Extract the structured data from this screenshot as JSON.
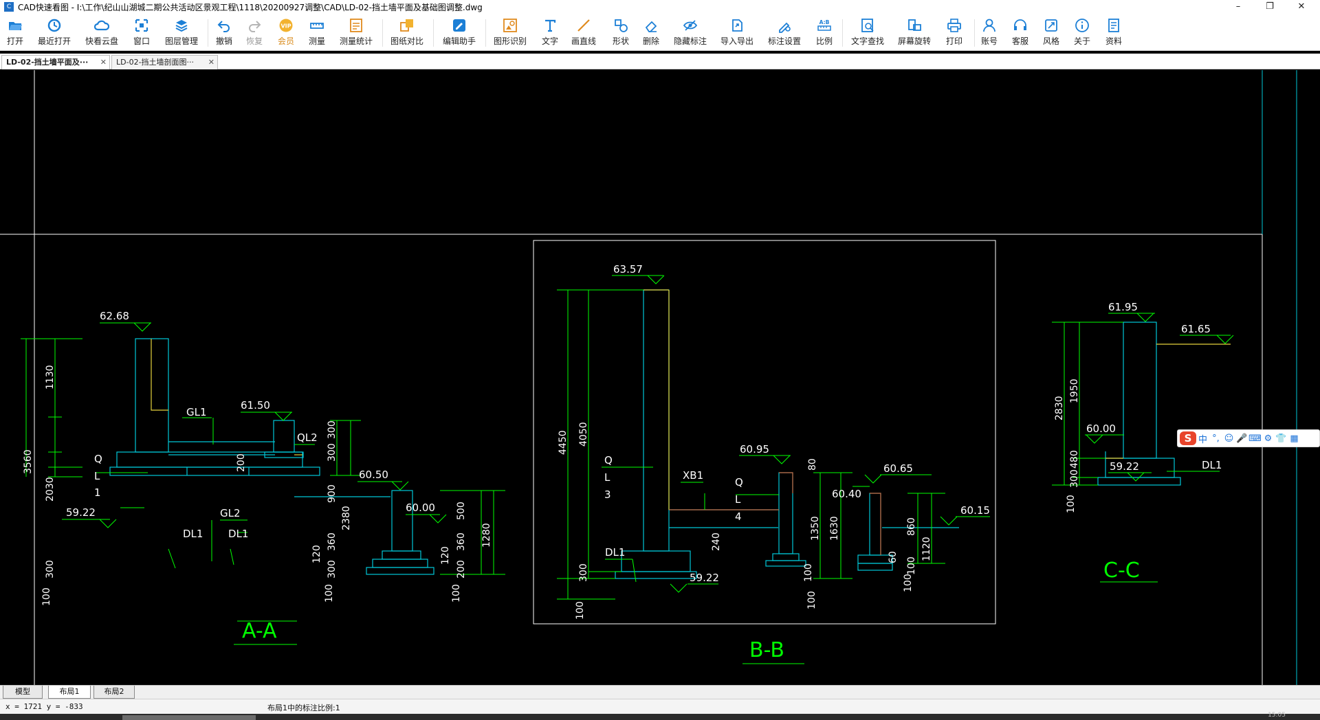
{
  "window": {
    "app_icon_text": "C",
    "title": "CAD快速看图 - I:\\工作\\纪山山湖城二期公共活动区景观工程\\1118\\20200927调整\\CAD\\LD-02-挡土墙平面及基础图调整.dwg",
    "minimize": "–",
    "maximize": "❐",
    "close": "✕"
  },
  "toolbar": {
    "items": [
      {
        "label": "打开",
        "icon": "folder-open-icon"
      },
      {
        "label": "最近打开",
        "icon": "recent-clock-icon"
      },
      {
        "label": "快看云盘",
        "icon": "cloud-icon"
      },
      {
        "label": "窗口",
        "icon": "window-icon"
      },
      {
        "label": "图层管理",
        "icon": "layers-icon"
      },
      {
        "label": "撤销",
        "icon": "undo-icon"
      },
      {
        "label": "恢复",
        "icon": "redo-icon"
      },
      {
        "label": "会员",
        "icon": "vip-icon"
      },
      {
        "label": "测量",
        "icon": "ruler-icon"
      },
      {
        "label": "测量统计",
        "icon": "measure-stats-icon"
      },
      {
        "label": "图纸对比",
        "icon": "compare-icon"
      },
      {
        "label": "编辑助手",
        "icon": "edit-assistant-icon"
      },
      {
        "label": "图形识别",
        "icon": "shape-recognize-icon"
      },
      {
        "label": "文字",
        "icon": "text-icon"
      },
      {
        "label": "画直线",
        "icon": "line-icon"
      },
      {
        "label": "形状",
        "icon": "shapes-icon"
      },
      {
        "label": "删除",
        "icon": "eraser-icon"
      },
      {
        "label": "隐藏标注",
        "icon": "hide-annotation-icon"
      },
      {
        "label": "导入导出",
        "icon": "import-export-icon"
      },
      {
        "label": "标注设置",
        "icon": "annotation-settings-icon"
      },
      {
        "label": "比例",
        "icon": "scale-icon"
      },
      {
        "label": "文字查找",
        "icon": "text-search-icon"
      },
      {
        "label": "屏幕旋转",
        "icon": "rotate-screen-icon"
      },
      {
        "label": "打印",
        "icon": "printer-icon"
      },
      {
        "label": "账号",
        "icon": "account-icon"
      },
      {
        "label": "客服",
        "icon": "headset-icon"
      },
      {
        "label": "风格",
        "icon": "style-icon"
      },
      {
        "label": "关于",
        "icon": "info-icon"
      },
      {
        "label": "资料",
        "icon": "documents-icon"
      }
    ]
  },
  "tabs": [
    {
      "label": "LD-02-挡土墙平面及···",
      "active": true,
      "close": "✕"
    },
    {
      "label": "LD-02-挡土墙剖面图···",
      "active": false,
      "close": "✕"
    }
  ],
  "drawing": {
    "sections": {
      "aa": {
        "title": "A-A"
      },
      "bb": {
        "title": "B-B"
      },
      "cc": {
        "title": "C-C"
      }
    },
    "elevations": [
      "62.68",
      "61.50",
      "60.50",
      "60.00",
      "59.22",
      "63.57",
      "60.95",
      "60.40",
      "60.65",
      "60.15",
      "59.22",
      "61.95",
      "61.65",
      "60.00",
      "59.22"
    ],
    "member_labels": [
      "GL1",
      "QL2",
      "Q",
      "L",
      "1",
      "GL2",
      "DL1",
      "DL1",
      "Q",
      "L",
      "3",
      "XB1",
      "Q",
      "L",
      "4",
      "DL1",
      "DL1"
    ],
    "dimensions_aa": [
      "1130",
      "3560",
      "2030",
      "300",
      "100",
      "200",
      "300",
      "300",
      "900",
      "2380",
      "360",
      "300",
      "120",
      "100",
      "500",
      "360",
      "1280",
      "120",
      "200",
      "100"
    ],
    "dimensions_bb": [
      "4450",
      "4050",
      "300",
      "100",
      "240",
      "80",
      "1350",
      "1630",
      "100",
      "100",
      "860",
      "1120",
      "100",
      "60",
      "100"
    ],
    "dimensions_cc": [
      "2830",
      "1950",
      "480",
      "300",
      "100"
    ]
  },
  "ime": {
    "logo": "S",
    "glyphs": [
      "中",
      "°,",
      "☺",
      "🎤",
      "⌨",
      "⚙",
      "👕",
      "▦"
    ]
  },
  "layouts": [
    {
      "label": "模型",
      "active": false
    },
    {
      "label": "布局1",
      "active": true
    },
    {
      "label": "布局2",
      "active": false
    }
  ],
  "status": {
    "coords": "x = 1721  y = -833",
    "scale": "布局1中的标注比例:1",
    "clock": "15:05"
  },
  "colors": {
    "green": "#00ff00",
    "cyan": "#00c8d8",
    "yellow": "#e6d23c",
    "orange": "#c8643c",
    "white": "#ffffff"
  }
}
